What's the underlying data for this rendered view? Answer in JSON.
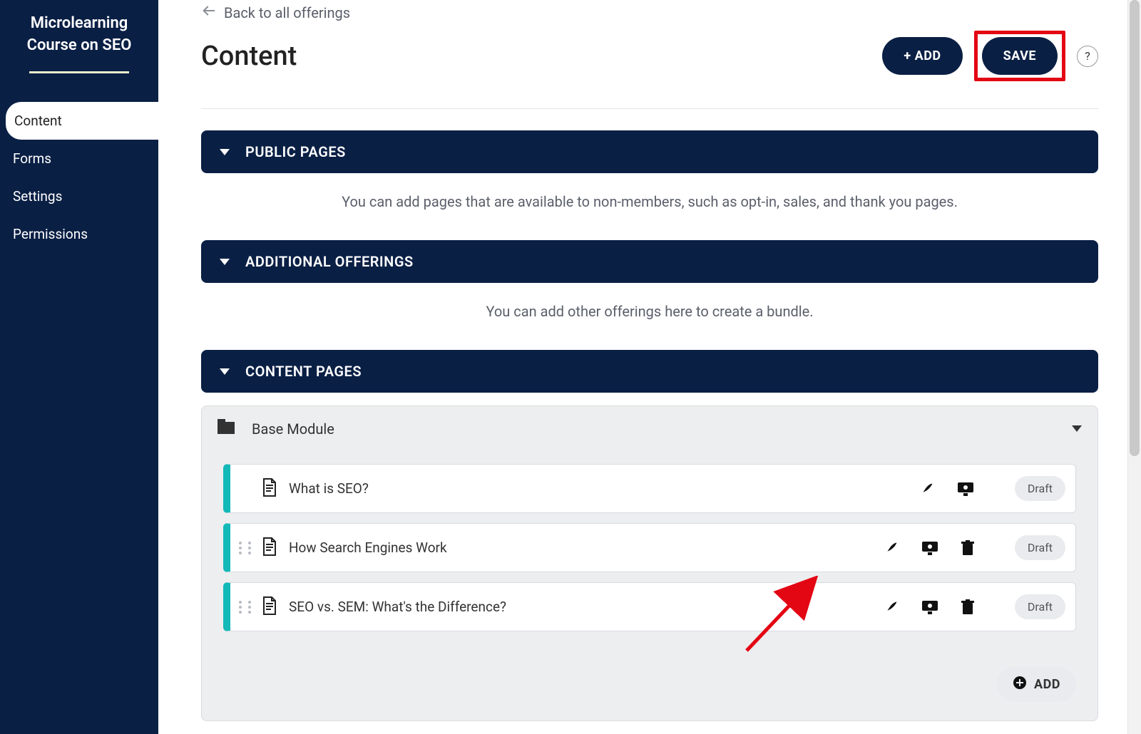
{
  "sidebar": {
    "courseTitle1": "Microlearning",
    "courseTitle2": "Course on SEO",
    "items": [
      {
        "label": "Content",
        "active": true
      },
      {
        "label": "Forms",
        "active": false
      },
      {
        "label": "Settings",
        "active": false
      },
      {
        "label": "Permissions",
        "active": false
      }
    ]
  },
  "header": {
    "backLabel": "Back to all offerings",
    "title": "Content",
    "addLabel": "+ ADD",
    "saveLabel": "SAVE",
    "help": "?"
  },
  "sections": {
    "public": {
      "title": "PUBLIC PAGES",
      "help": "You can add pages that are available to non-members, such as opt-in, sales, and thank you pages."
    },
    "additional": {
      "title": "ADDITIONAL OFFERINGS",
      "help": "You can add other offerings here to create a bundle."
    },
    "content": {
      "title": "CONTENT PAGES"
    }
  },
  "module": {
    "name": "Base Module",
    "addLabel": "ADD",
    "pages": [
      {
        "title": "What is SEO?",
        "status": "Draft",
        "showDrag": false,
        "showTrash": false
      },
      {
        "title": "How Search Engines Work",
        "status": "Draft",
        "showDrag": true,
        "showTrash": true
      },
      {
        "title": "SEO vs. SEM: What's the Difference?",
        "status": "Draft",
        "showDrag": true,
        "showTrash": true
      }
    ]
  }
}
